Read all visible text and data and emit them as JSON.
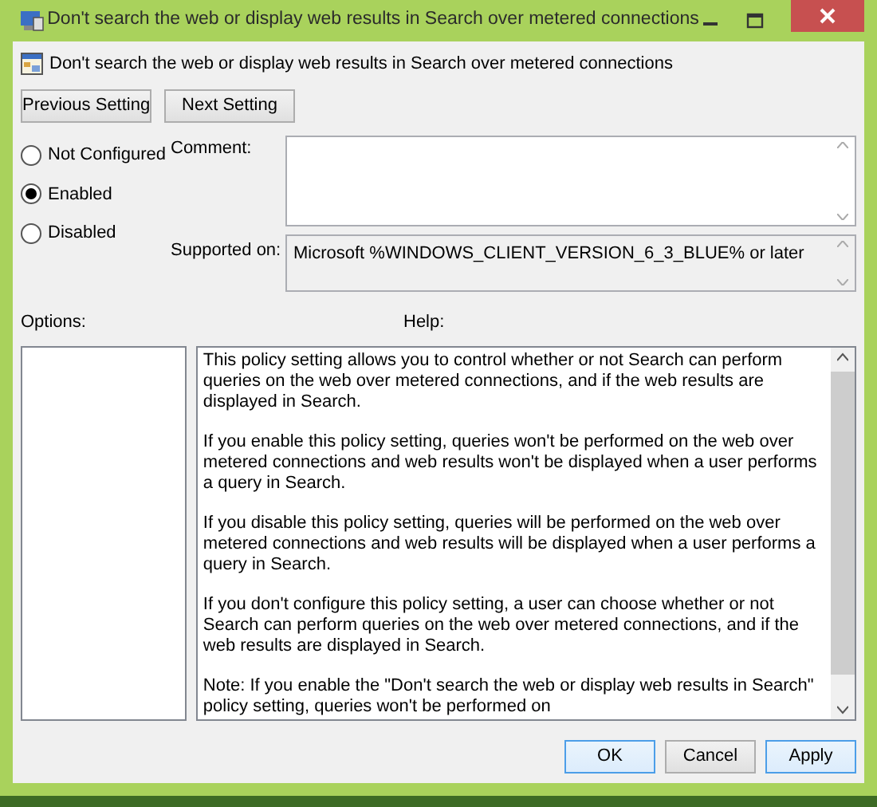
{
  "window": {
    "title": "Don't search the web or display web results in Search over metered connections"
  },
  "policy_title": "Don't search the web or display web results in Search over metered connections",
  "nav_buttons": [
    "Previous Setting",
    "Next Setting"
  ],
  "states": [
    {
      "label": "Not Configured",
      "selected": false
    },
    {
      "label": "Enabled",
      "selected": true
    },
    {
      "label": "Disabled",
      "selected": false
    }
  ],
  "comment": {
    "label": "Comment:"
  },
  "supported_on": {
    "label": "Supported on:",
    "value": "Microsoft %WINDOWS_CLIENT_VERSION_6_3_BLUE% or later"
  },
  "options": {
    "label": "Options:"
  },
  "help": {
    "label": "Help:",
    "paragraphs": [
      "This policy setting allows you to control whether or not Search can perform queries on the web over metered connections, and if the web results are displayed in Search.",
      "If you enable this policy setting, queries won't be performed on the web over metered connections and web results won't be displayed when a user performs a query in Search.",
      "If you disable this policy setting, queries will be performed on the web over metered connections and web results will be displayed when a user performs a query in Search.",
      "If you don't configure this policy setting, a user can choose whether or not Search can perform queries on the web over metered connections, and if the web results are displayed in Search.",
      "Note: If you enable the \"Don't search the web or display web results in Search\" policy setting, queries won't be performed on"
    ]
  },
  "buttons": [
    "OK",
    "Cancel",
    "Apply"
  ]
}
